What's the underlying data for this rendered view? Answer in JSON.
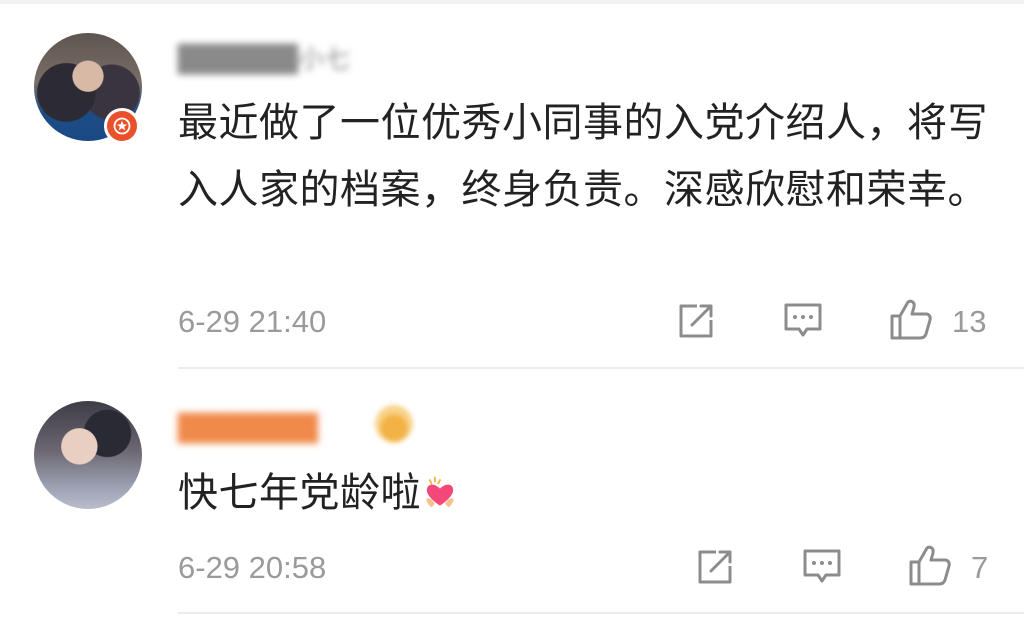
{
  "comments": [
    {
      "username": "██████小七",
      "text": "最近做了一位优秀小同事的入党介绍人，将写入人家的档案，终身负责。深感欣慰和荣幸。",
      "timestamp": "6-29 21:40",
      "like_count": "13",
      "verified_badge": "verified-badge-icon"
    },
    {
      "username": "███████",
      "text": "快七年党龄啦",
      "timestamp": "6-29 20:58",
      "like_count": "7",
      "emoji": "heart-hands-emoji-icon"
    }
  ],
  "colors": {
    "text": "#222222",
    "meta": "#9a9a9a",
    "divider": "#ececec",
    "badge": "#e9512b",
    "username_member": "#f08a4b"
  }
}
